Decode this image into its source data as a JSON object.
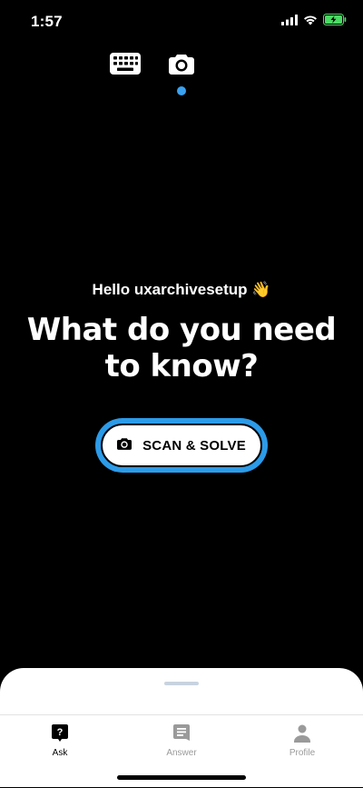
{
  "status_bar": {
    "time": "1:57",
    "icons": [
      "signal-icon",
      "wifi-icon",
      "battery-charging-icon"
    ],
    "battery_color": "#4cd964"
  },
  "mode_switch": {
    "options": [
      "keyboard-icon",
      "camera-icon"
    ],
    "active": "camera",
    "indicator_color": "#3aa1ef"
  },
  "main": {
    "greeting": "Hello uxarchivesetup 👋",
    "headline": "What do you need to know?",
    "scan_button_label": "SCAN & SOLVE",
    "scan_button_icon": "camera-icon",
    "accent_color": "#2c9be8"
  },
  "tabbar": {
    "tabs": [
      {
        "label": "Ask",
        "icon": "question-bubble-icon",
        "active": true
      },
      {
        "label": "Answer",
        "icon": "answer-doc-icon",
        "active": false
      },
      {
        "label": "Profile",
        "icon": "person-icon",
        "active": false
      }
    ]
  }
}
